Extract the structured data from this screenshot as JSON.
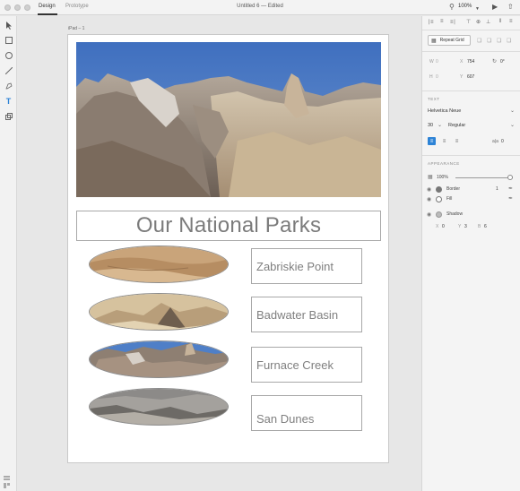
{
  "window": {
    "tabs": [
      {
        "label": "Design",
        "active": true
      },
      {
        "label": "Prototype",
        "active": false
      }
    ],
    "doc_title": "Untitled 6 — Edited",
    "zoom": "100%"
  },
  "toolbar": {
    "tools": [
      {
        "name": "select-tool",
        "icon": "arrow-icon",
        "active": false
      },
      {
        "name": "rectangle-tool",
        "icon": "rectangle-icon",
        "active": false
      },
      {
        "name": "ellipse-tool",
        "icon": "ellipse-icon",
        "active": false
      },
      {
        "name": "line-tool",
        "icon": "line-icon",
        "active": false
      },
      {
        "name": "pen-tool",
        "icon": "pen-icon",
        "active": false
      },
      {
        "name": "text-tool",
        "icon": "text-icon",
        "active": true
      },
      {
        "name": "artboard-tool",
        "icon": "artboard-icon",
        "active": false
      }
    ]
  },
  "artboard": {
    "label": "iPad – 1",
    "title": "Our National Parks",
    "parks": [
      {
        "name": "Zabriskie Point"
      },
      {
        "name": "Badwater Basin"
      },
      {
        "name": "Furnace Creek"
      },
      {
        "name": "San Dunes"
      }
    ]
  },
  "panel": {
    "repeat_grid_label": "Repeat Grid",
    "w_label": "W",
    "w_value": "0",
    "x_label": "X",
    "x_value": "754",
    "rotation_value": "0°",
    "h_label": "H",
    "h_value": "0",
    "y_label": "Y",
    "y_value": "607",
    "text_section": "TEXT",
    "font_family": "Helvetica Neue",
    "font_size": "30",
    "font_weight": "Regular",
    "char_spacing": "0",
    "appearance_section": "APPEARANCE",
    "opacity": "100%",
    "opacity_value": 1.0,
    "border_label": "Border",
    "border_value": "1",
    "fill_label": "Fill",
    "shadow_label": "Shadow",
    "shadow_x_label": "X",
    "shadow_x": "0",
    "shadow_y_label": "Y",
    "shadow_y": "3",
    "shadow_b_label": "B",
    "shadow_b": "6"
  },
  "colors": {
    "accent": "#2d83d6",
    "sky": "#4a78c0"
  }
}
